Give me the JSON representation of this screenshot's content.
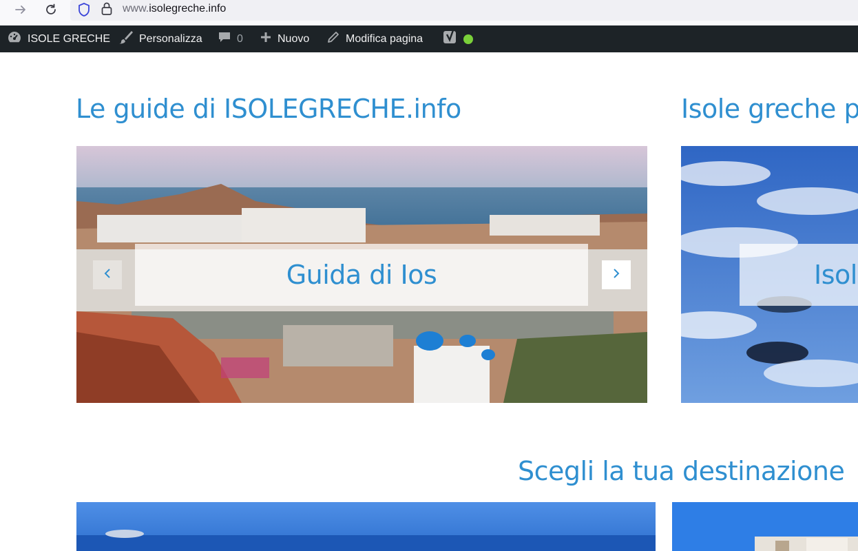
{
  "browser": {
    "url_prefix": "www.",
    "url_domain": "isolegreche.info"
  },
  "admin_bar": {
    "site_name": "ISOLE GRECHE",
    "customize": "Personalizza",
    "comments_count": "0",
    "new": "Nuovo",
    "edit_page": "Modifica pagina"
  },
  "sections": {
    "guides_title": "Le guide di ISOLEGRECHE.info",
    "second_title": "Isole greche per",
    "destinations_title": "Scegli la tua destinazione"
  },
  "slider_main": {
    "caption": "Guida di Ios"
  },
  "slider_second": {
    "caption": "Isole"
  },
  "colors": {
    "accent": "#2f8fd0",
    "admin_bar_bg": "#1d2327",
    "status_dot": "#7ad03a"
  }
}
